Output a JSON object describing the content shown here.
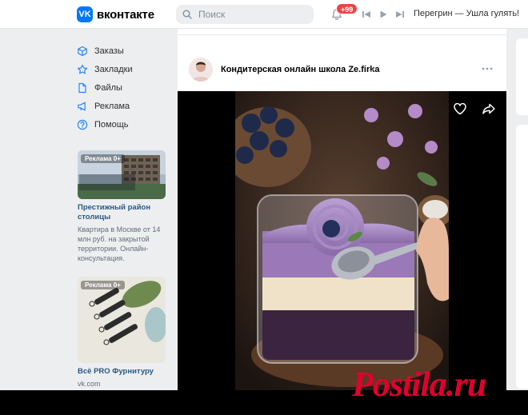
{
  "header": {
    "logo_text": "вконтакте",
    "search_placeholder": "Поиск",
    "notifications_badge": "+99",
    "now_playing": "Перегрин — Ушла гулять!"
  },
  "menu": {
    "items": [
      {
        "label": "Заказы",
        "icon": "box-icon"
      },
      {
        "label": "Закладки",
        "icon": "star-icon"
      },
      {
        "label": "Файлы",
        "icon": "file-icon"
      },
      {
        "label": "Реклама",
        "icon": "megaphone-icon"
      },
      {
        "label": "Помощь",
        "icon": "help-icon"
      }
    ]
  },
  "ads": [
    {
      "tag": "Реклама 0+",
      "title": "Престижный район столицы",
      "desc": "Квартира в Москве от 14 млн руб. на закрытой территории. Онлайн-консультация."
    },
    {
      "tag": "Реклама 0+",
      "title": "Всё PRO Фурнитуру",
      "desc": "vk.com"
    }
  ],
  "post": {
    "author": "Кондитерская онлайн школа Ze.firka"
  },
  "watermark": "Postila.ru",
  "colors": {
    "accent": "#0077ff",
    "link": "#2a5885",
    "badge": "#e64646",
    "watermark": "#e0002d"
  }
}
